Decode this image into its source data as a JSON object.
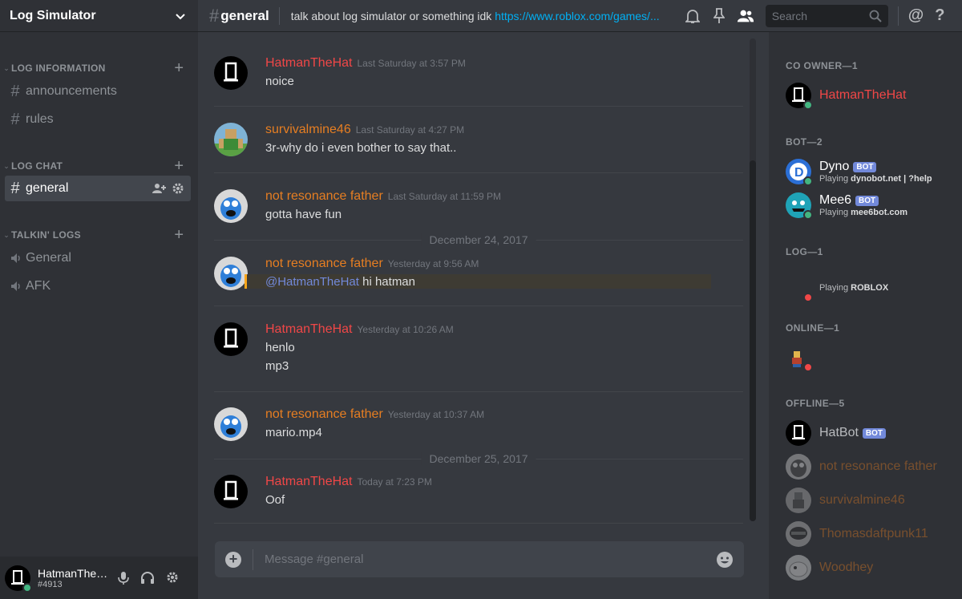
{
  "guild": {
    "name": "Log Simulator"
  },
  "categories": [
    {
      "label": "LOG INFORMATION"
    },
    {
      "label": "LOG CHAT"
    },
    {
      "label": "TALKIN' LOGS"
    }
  ],
  "channels": {
    "announcements": "announcements",
    "rules": "rules",
    "general": "general",
    "voice_general": "General",
    "voice_afk": "AFK",
    "hash": "#"
  },
  "user": {
    "name": "HatmanTheH..",
    "discriminator": "#4913"
  },
  "header": {
    "channel": "general",
    "topic_text": "talk about log simulator or something idk ",
    "topic_link": "https://www.roblox.com/games/...",
    "search_placeholder": "Search",
    "at_symbol": "@",
    "help_symbol": "?"
  },
  "colors": {
    "red": "#f04747",
    "orange": "#e67e22",
    "mention_bg": "#3e3b33",
    "accent": "#7289da"
  },
  "messages": [
    {
      "author": "HatmanTheHat",
      "timestamp": "Last Saturday at 3:57 PM",
      "lines": [
        "noice"
      ]
    },
    {
      "author": "survivalmine46",
      "timestamp": "Last Saturday at 4:27 PM",
      "lines": [
        "3r-why do i even bother to say that.."
      ]
    },
    {
      "author": "not resonance father",
      "timestamp": "Last Saturday at 11:59 PM",
      "lines": [
        "gotta have fun"
      ]
    },
    {
      "author": "not resonance father",
      "timestamp": "Yesterday at 9:56 AM",
      "mention": "@HatmanTheHat",
      "lines": [
        " hi hatman"
      ]
    },
    {
      "author": "HatmanTheHat",
      "timestamp": "Yesterday at 10:26 AM",
      "lines": [
        "henlo",
        "mp3"
      ]
    },
    {
      "author": "not resonance father",
      "timestamp": "Yesterday at 10:37 AM",
      "lines": [
        "mario.mp4"
      ]
    },
    {
      "author": "HatmanTheHat",
      "timestamp": "Today at 7:23 PM",
      "lines": [
        "Oof"
      ]
    }
  ],
  "dividers": [
    "December 24, 2017",
    "December 25, 2017"
  ],
  "composer": {
    "placeholder": "Message #general"
  },
  "members": {
    "groups": [
      "CO OWNER—1",
      "BOT—2",
      "LOG—1",
      "ONLINE—1",
      "OFFLINE—5"
    ],
    "co_owner": {
      "name": "HatmanTheHat"
    },
    "dyno": {
      "name": "Dyno",
      "badge": "BOT",
      "playing": "Playing ",
      "game": "dynobot.net | ?help"
    },
    "mee6": {
      "name": "Mee6",
      "badge": "BOT",
      "playing": "Playing ",
      "game": "mee6bot.com"
    },
    "log_member": {
      "playing": "Playing ",
      "game": "ROBLOX"
    },
    "offline": [
      {
        "name": "HatBot",
        "badge": "BOT"
      },
      {
        "name": "not resonance father"
      },
      {
        "name": "survivalmine46"
      },
      {
        "name": "Thomasdaftpunk11"
      },
      {
        "name": "Woodhey"
      }
    ]
  }
}
